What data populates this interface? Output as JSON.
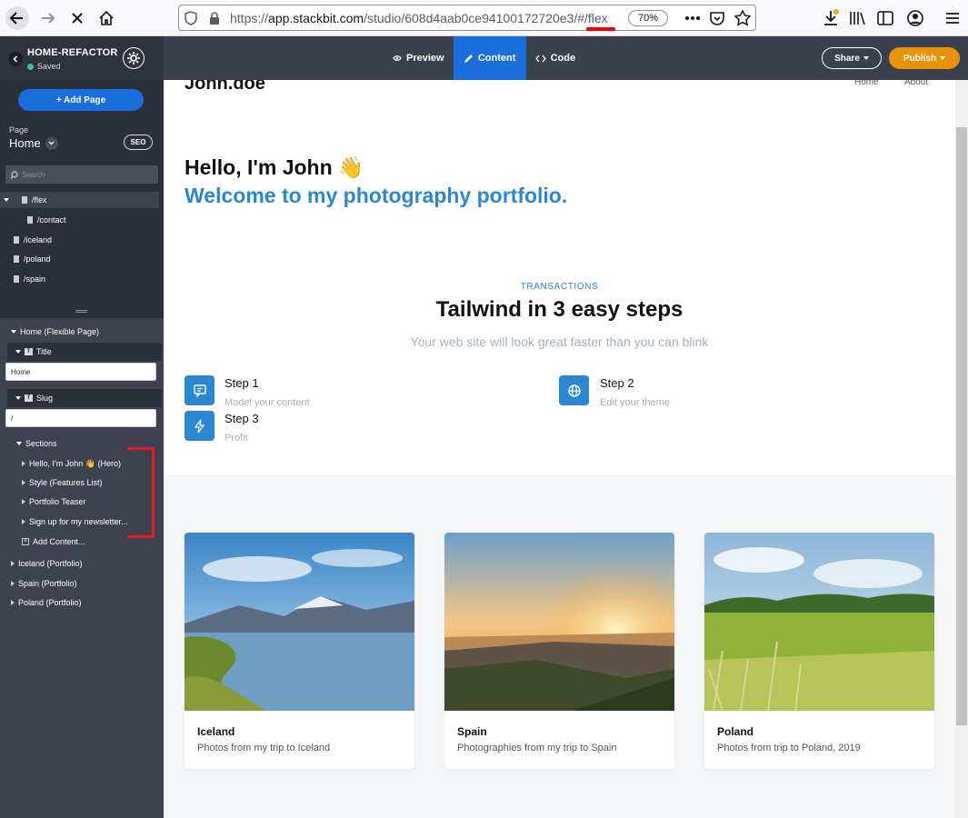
{
  "browser": {
    "url_host": "app.stackbit.com",
    "url_prefix": "https://",
    "url_path": "/studio/608d4aab0ce94100172720e3/#/flex",
    "zoom": "70%"
  },
  "header": {
    "project_name": "HOME-REFACTOR",
    "status": "Saved",
    "tabs": [
      {
        "label": "Preview"
      },
      {
        "label": "Content"
      },
      {
        "label": "Code"
      }
    ],
    "share_label": "Share",
    "publish_label": "Publish"
  },
  "sidebar": {
    "add_page_label": "+ Add Page",
    "page_label": "Page",
    "page_value": "Home",
    "seo_label": "SEO",
    "search_placeholder": "Search",
    "pages": [
      {
        "label": "/flex"
      },
      {
        "label": "/contact"
      },
      {
        "label": "/iceland"
      },
      {
        "label": "/poland"
      },
      {
        "label": "/spain"
      }
    ],
    "tree": {
      "root": "Home (Flexible Page)",
      "title_field": "Title",
      "title_value": "Home",
      "slug_field": "Slug",
      "slug_value": "/",
      "sections_label": "Sections",
      "sections": [
        {
          "label": "Hello, I'm John 👋 (Hero)"
        },
        {
          "label": "Style (Features List)"
        },
        {
          "label": "Portfolio Teaser"
        },
        {
          "label": "Sign up for my newsletter..."
        }
      ],
      "add_content": "Add Content...",
      "portfolios": [
        {
          "label": "Iceland (Portfolio)"
        },
        {
          "label": "Spain (Portfolio)"
        },
        {
          "label": "Poland (Portfolio)"
        }
      ]
    }
  },
  "site": {
    "logo": "John.doe",
    "nav": [
      "Home",
      "About"
    ],
    "hero_title": "Hello, I'm John",
    "hero_emoji": "👋",
    "hero_subtitle": "Welcome to my photography portfolio.",
    "eyebrow": "TRANSACTIONS",
    "features_title": "Tailwind in 3 easy steps",
    "features_subtitle": "Your web site will look great faster than you can blink",
    "steps": [
      {
        "title": "Step 1",
        "desc": "Model your content",
        "icon": "chat-icon"
      },
      {
        "title": "Step 2",
        "desc": "Edit your theme",
        "icon": "globe-icon"
      },
      {
        "title": "Step 3",
        "desc": "Profit",
        "icon": "lightning-icon"
      }
    ],
    "cards": [
      {
        "title": "Iceland",
        "desc": "Photos from my trip to Iceland"
      },
      {
        "title": "Spain",
        "desc": "Photographies from my trip to Spain"
      },
      {
        "title": "Poland",
        "desc": "Photos from trip to Poland, 2019"
      }
    ]
  },
  "colors": {
    "accent": "#1a6edb",
    "publish": "#e8940a",
    "link_blue": "#2b87d1",
    "annotation_red": "#e41b23"
  }
}
